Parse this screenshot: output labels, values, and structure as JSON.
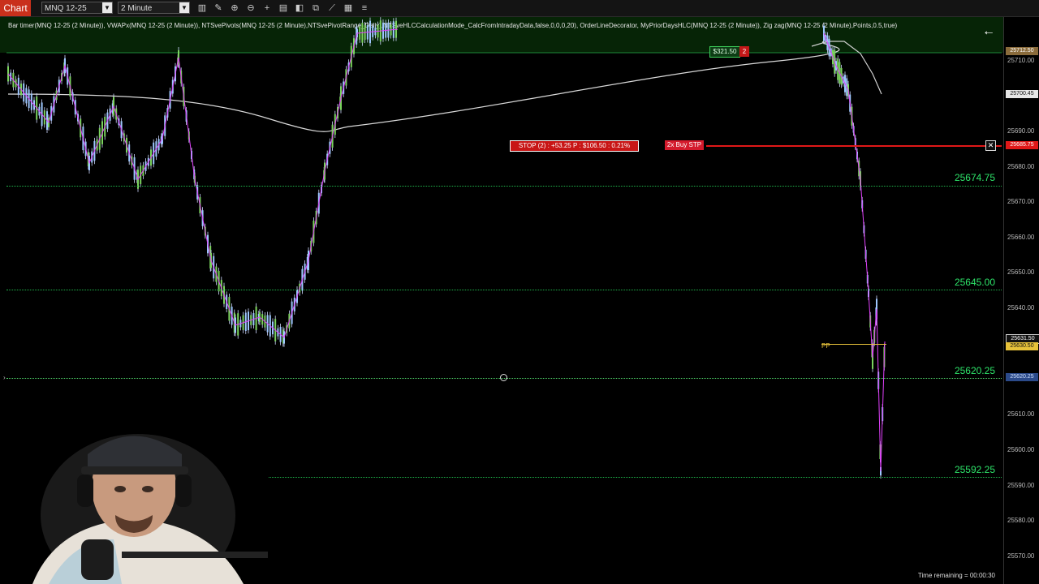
{
  "toolbar": {
    "chart_tab": "Chart",
    "instrument": "MNQ 12-25",
    "interval": "2 Minute",
    "icons": [
      "bar-type-icon",
      "pencil-icon",
      "zoom-in-icon",
      "zoom-out-icon",
      "crosshair-icon",
      "properties-icon",
      "export-icon",
      "indicators-icon",
      "strategies-icon",
      "drawing-icon",
      "templates-icon",
      "menu-icon"
    ]
  },
  "indicators": {
    "text": "Bar timer(MNQ 12-25 (2 Minute)), VWAPx(MNQ 12-25 (2 Minute)), NTSvePivots(MNQ 12-25 (2 Minute),NTSvePivotRange_Daily),NTSveHLCCalculationMode_CalcFromIntradayData,false,0,0,0,20), OrderLineDecorator, MyPriorDaysHLC(MNQ 12-25 (2 Minute)), Zig zag(MNQ 12-25 (2 Minute),Points,0.5,true)"
  },
  "levels": [
    {
      "label": "25674.75",
      "price": 25674.75
    },
    {
      "label": "25645.00",
      "price": 25645.0
    },
    {
      "label": "25620.25",
      "price": 25620.25
    },
    {
      "label": "25592.25",
      "price": 25592.25
    }
  ],
  "order": {
    "stop_text": "STOP (2) : +53.25 P : $106.50 : 0.21%",
    "buy_text": "2x Buy STP",
    "close_symbol": "✕",
    "price_tag": "25685.75"
  },
  "position": {
    "pnl": "$321.50",
    "qty": "2"
  },
  "pivot": {
    "label": "PP"
  },
  "axis": {
    "ticks": [
      "25710.00",
      "25700.00",
      "25690.00",
      "25680.00",
      "25670.00",
      "25660.00",
      "25650.00",
      "25640.00",
      "25630.00",
      "25620.00",
      "25610.00",
      "25600.00",
      "25590.00",
      "25580.00",
      "25570.00"
    ],
    "tag_top": "25712.50",
    "tag_vwap": "25700.45",
    "tag_last": "25631.50",
    "tag_pp": "25630.50",
    "tag_level": "25620.25"
  },
  "status": {
    "time_remaining": "Time remaining = 00:00:30"
  },
  "colors": {
    "accent": "#c9301c",
    "level": "#2ee56a",
    "stop": "#e01818",
    "up_bar": "#7bd35e",
    "down_bar": "#9ec7ff",
    "vwap": "#d9d9d9",
    "zigzag": "#e040fb",
    "pivot": "#e7c23a"
  }
}
